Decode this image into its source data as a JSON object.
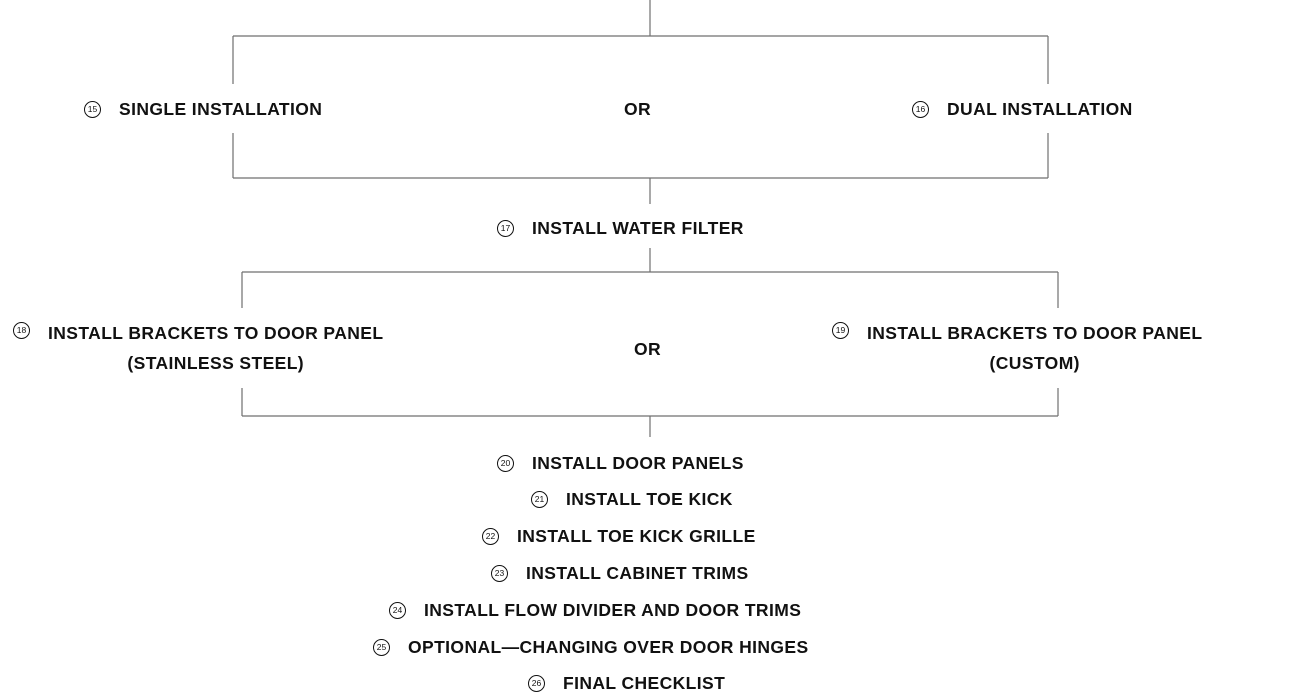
{
  "diagram": {
    "branch_a": {
      "left": {
        "num": "15",
        "label": "SINGLE INSTALLATION"
      },
      "separator": "OR",
      "right": {
        "num": "16",
        "label": "DUAL INSTALLATION"
      }
    },
    "step_17": {
      "num": "17",
      "label": "INSTALL WATER FILTER"
    },
    "branch_b": {
      "left": {
        "num": "18",
        "line1": "INSTALL BRACKETS TO DOOR PANEL",
        "line2": "(STAINLESS STEEL)"
      },
      "separator": "OR",
      "right": {
        "num": "19",
        "line1": "INSTALL BRACKETS TO DOOR PANEL",
        "line2": "(CUSTOM)"
      }
    },
    "steps": [
      {
        "num": "20",
        "label": "INSTALL DOOR PANELS"
      },
      {
        "num": "21",
        "label": "INSTALL TOE KICK"
      },
      {
        "num": "22",
        "label": "INSTALL TOE KICK GRILLE"
      },
      {
        "num": "23",
        "label": "INSTALL CABINET TRIMS"
      },
      {
        "num": "24",
        "label": "INSTALL FLOW DIVIDER AND DOOR TRIMS"
      },
      {
        "num": "25",
        "label": "OPTIONAL—CHANGING OVER DOOR HINGES"
      },
      {
        "num": "26",
        "label": "FINAL CHECKLIST"
      }
    ]
  }
}
